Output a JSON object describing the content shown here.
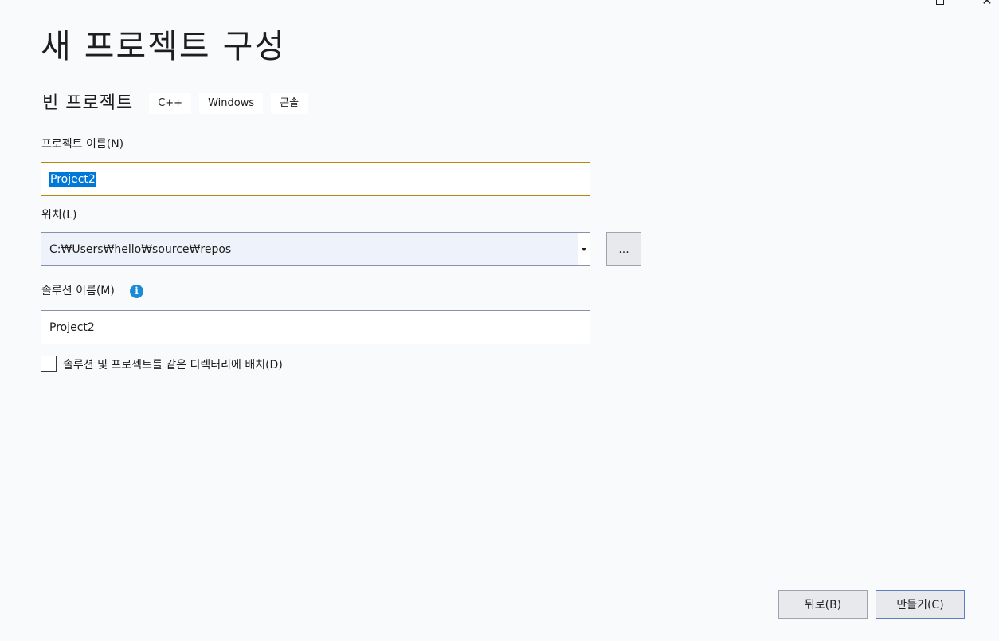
{
  "window": {
    "title": "새 프로젝트 구성"
  },
  "template": {
    "name": "빈 프로젝트",
    "tags": [
      "C++",
      "Windows",
      "콘솔"
    ]
  },
  "project_name": {
    "label": "프로젝트 이름(N)",
    "value": "Project2"
  },
  "location": {
    "label": "위치(L)",
    "value": "C:₩Users₩hello₩source₩repos",
    "browse_label": "..."
  },
  "solution_name": {
    "label": "솔루션 이름(M)",
    "value": "Project2",
    "info_glyph": "i"
  },
  "same_directory": {
    "label": "솔루션 및 프로젝트를 같은 디렉터리에 배치(D)",
    "checked": false
  },
  "footer": {
    "back_label": "뒤로(B)",
    "create_label": "만들기(C)"
  },
  "colors": {
    "background": "#f9fafb",
    "selection": "#0078d7",
    "focus_border": "#b8860b",
    "info_icon": "#1a8bd6"
  }
}
